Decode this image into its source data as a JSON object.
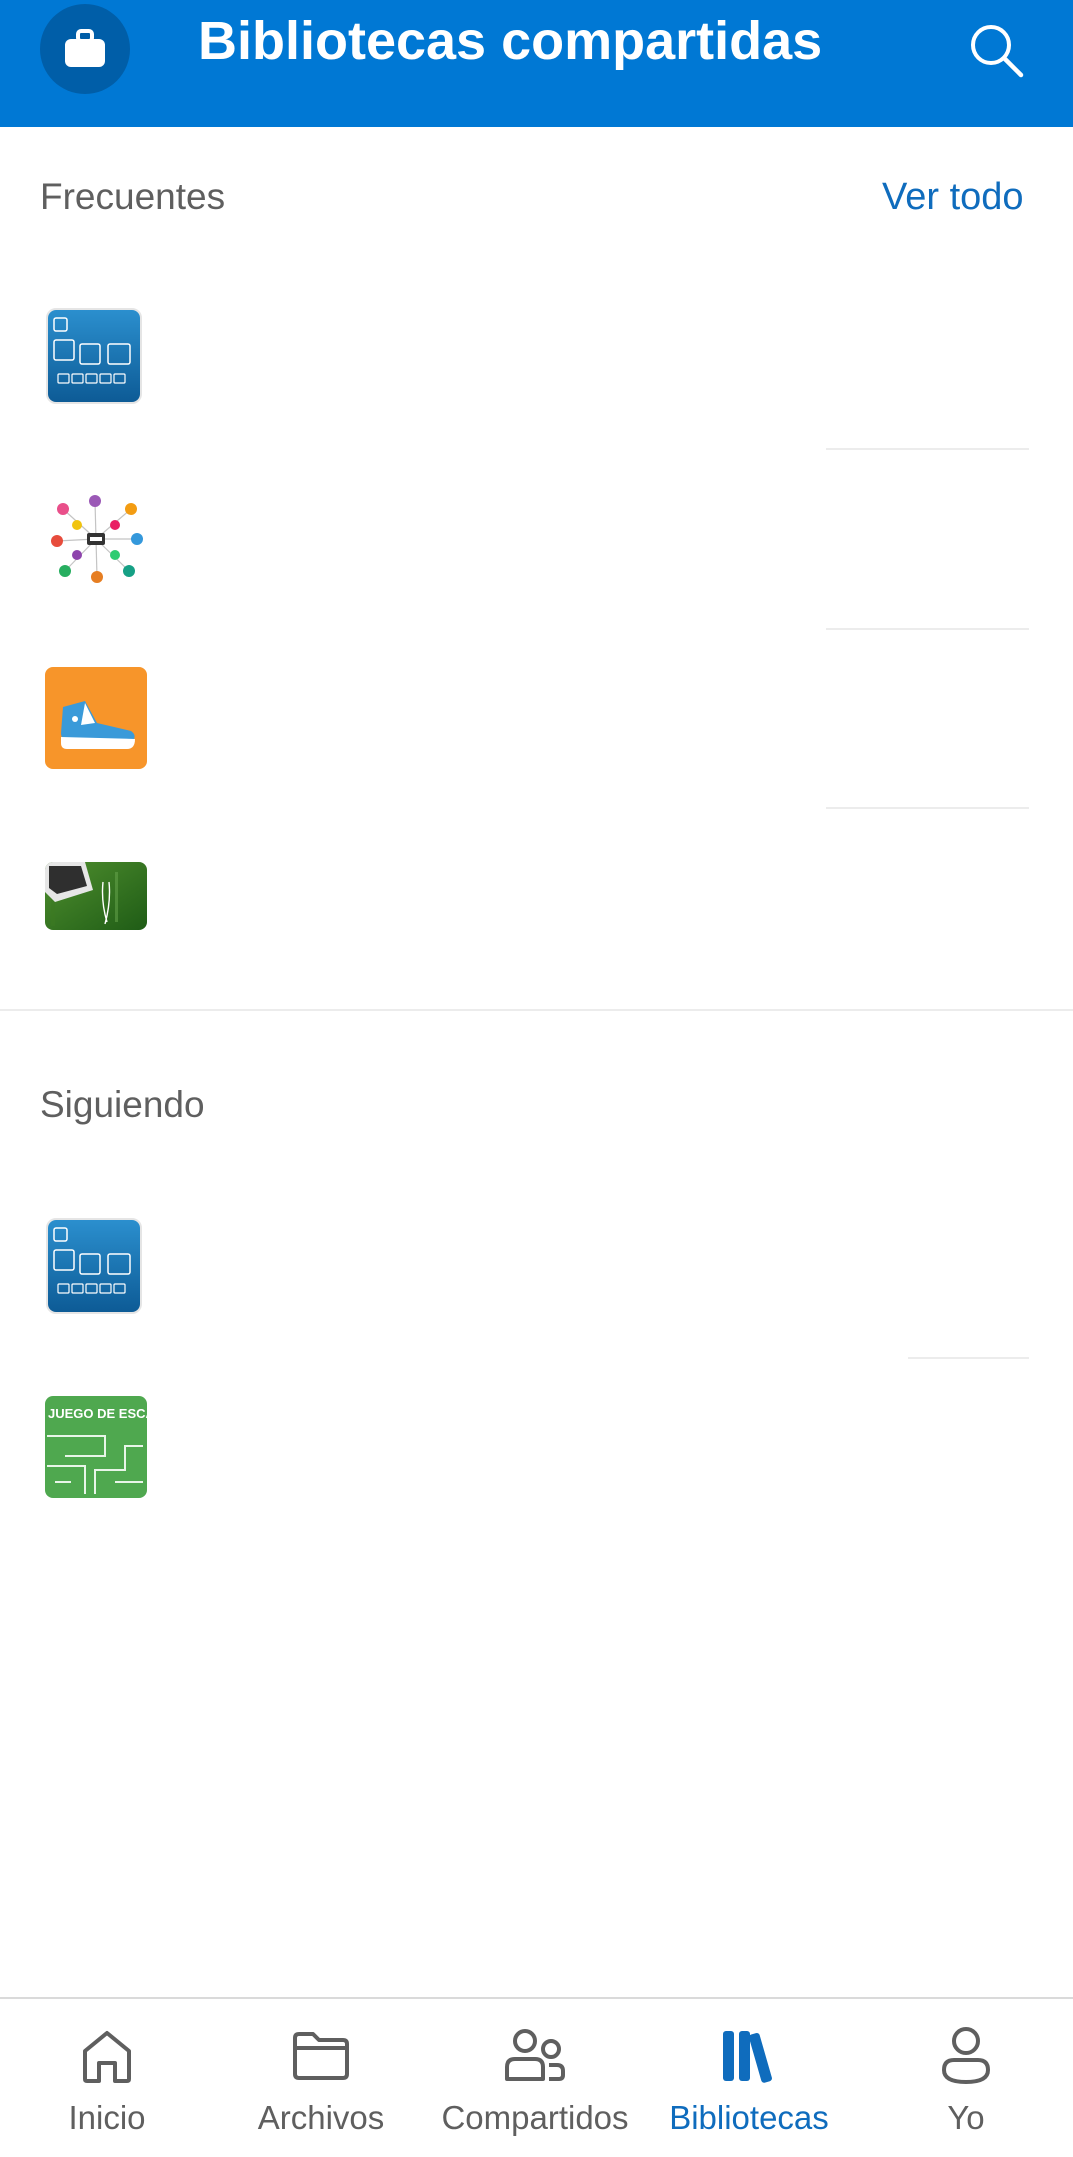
{
  "header": {
    "title": "Bibliotecas compartidas",
    "avatar_icon": "briefcase-icon",
    "search_icon": "search-icon"
  },
  "frecuentes": {
    "title": "Frecuentes",
    "see_all": "Ver todo",
    "items": [
      {
        "thumbnail": "code-keyboard-thumbnail"
      },
      {
        "thumbnail": "network-diagram-thumbnail"
      },
      {
        "thumbnail": "sneaker-thumbnail"
      },
      {
        "thumbnail": "laptop-grass-thumbnail"
      }
    ]
  },
  "siguiendo": {
    "title": "Siguiendo",
    "items": [
      {
        "thumbnail": "code-keyboard-thumbnail"
      },
      {
        "thumbnail": "escape-game-thumbnail",
        "thumbnail_text": "JUEGO DE ESCAPE"
      }
    ]
  },
  "bottom_nav": {
    "items": [
      {
        "label": "Inicio",
        "icon": "home-icon"
      },
      {
        "label": "Archivos",
        "icon": "folder-icon"
      },
      {
        "label": "Compartidos",
        "icon": "people-icon"
      },
      {
        "label": "Bibliotecas",
        "icon": "library-icon",
        "active": true
      },
      {
        "label": "Yo",
        "icon": "person-icon"
      }
    ]
  },
  "colors": {
    "accent": "#0078d4",
    "link": "#0f6cbd",
    "text_secondary": "#5f5f5f"
  }
}
